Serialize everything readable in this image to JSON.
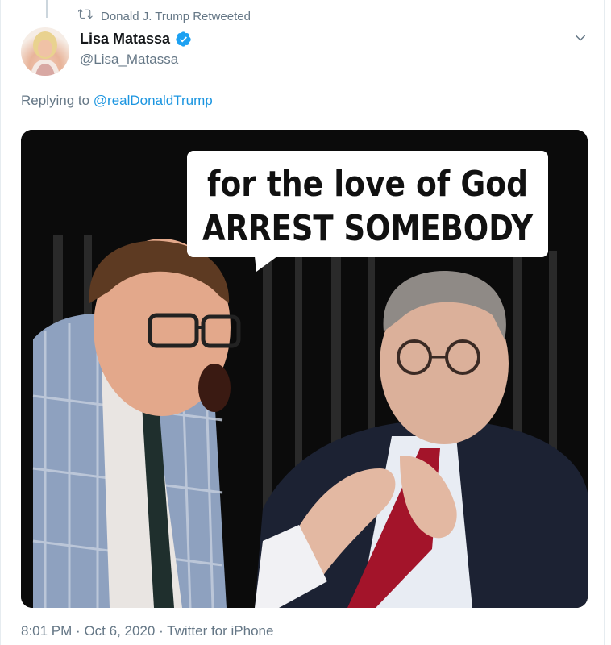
{
  "retweet": {
    "icon": "retweet-icon",
    "text": "Donald J. Trump Retweeted"
  },
  "author": {
    "name": "Lisa Matassa",
    "handle": "@Lisa_Matassa",
    "verified_icon": "verified-badge-icon",
    "verified_color": "#1da1f2"
  },
  "menu": {
    "icon": "chevron-down-icon"
  },
  "reply": {
    "prefix": "Replying to ",
    "mention": "@realDonaldTrump",
    "mention_color": "#1b95e0"
  },
  "media": {
    "speech_bubble": {
      "line1": "for the love of God",
      "line2": "ARREST SOMEBODY"
    }
  },
  "meta": {
    "time": "8:01 PM",
    "date": "Oct 6, 2020",
    "source": "Twitter for iPhone",
    "separator": "·"
  }
}
